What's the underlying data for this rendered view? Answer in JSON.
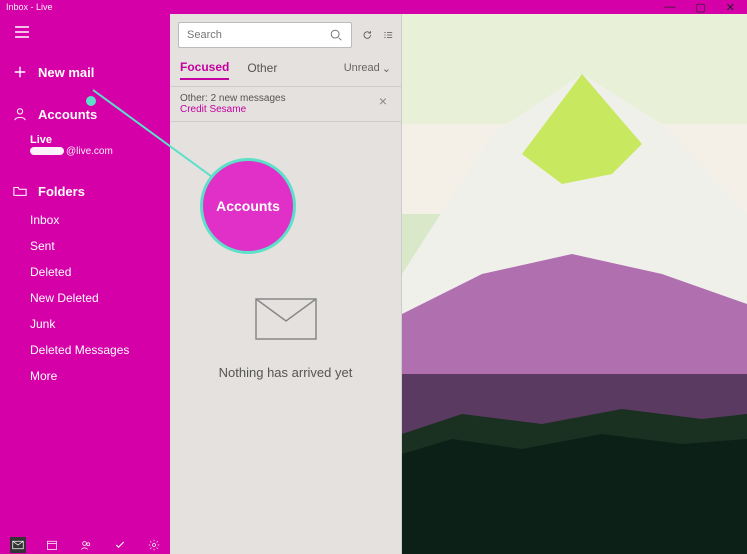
{
  "window": {
    "title": "Inbox - Live"
  },
  "sidebar": {
    "new_mail": "New mail",
    "accounts_label": "Accounts",
    "account": {
      "name": "Live",
      "email_domain": "@live.com"
    },
    "folders_label": "Folders",
    "folders": [
      {
        "label": "Inbox"
      },
      {
        "label": "Sent"
      },
      {
        "label": "Deleted"
      },
      {
        "label": "New Deleted"
      },
      {
        "label": "Junk"
      },
      {
        "label": "Deleted Messages"
      },
      {
        "label": "More"
      }
    ]
  },
  "search": {
    "placeholder": "Search"
  },
  "tabs": {
    "focused": "Focused",
    "other": "Other",
    "filter": "Unread"
  },
  "notice": {
    "line": "Other: 2 new messages",
    "link": "Credit Sesame"
  },
  "empty": {
    "message": "Nothing has arrived yet"
  },
  "callout": {
    "label": "Accounts"
  }
}
